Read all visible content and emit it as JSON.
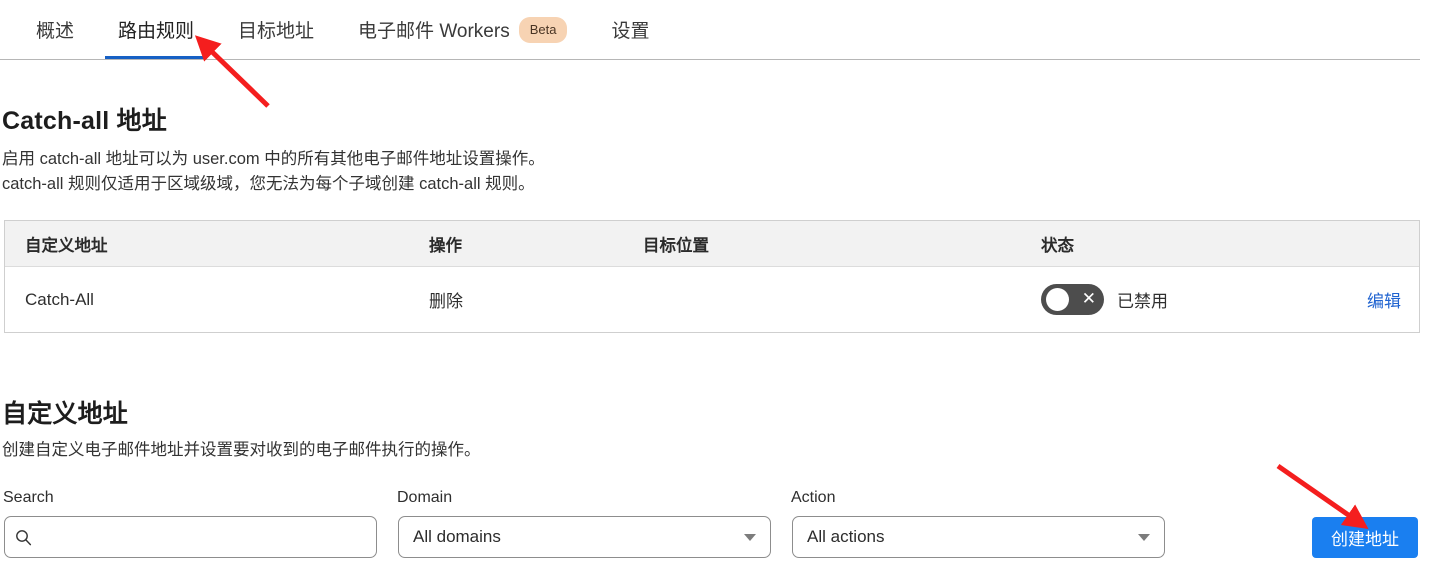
{
  "tabs": [
    {
      "label": "概述",
      "active": false,
      "badge": null
    },
    {
      "label": "路由规则",
      "active": true,
      "badge": null
    },
    {
      "label": "目标地址",
      "active": false,
      "badge": null
    },
    {
      "label": "电子邮件 Workers",
      "active": false,
      "badge": "Beta"
    },
    {
      "label": "设置",
      "active": false,
      "badge": null
    }
  ],
  "catchall": {
    "title": "Catch-all 地址",
    "description_line1": "启用 catch-all 地址可以为 user.com 中的所有其他电子邮件地址设置操作。",
    "description_line2": "catch-all 规则仅适用于区域级域，您无法为每个子域创建 catch-all 规则。",
    "table": {
      "headers": {
        "address": "自定义地址",
        "action": "操作",
        "target": "目标位置",
        "status": "状态"
      },
      "rows": [
        {
          "address": "Catch-All",
          "action": "删除",
          "target": "",
          "status_enabled": false,
          "status_text": "已禁用",
          "toggle_glyph": "✕",
          "edit_label": "编辑"
        }
      ]
    }
  },
  "custom": {
    "title": "自定义地址",
    "description": "创建自定义电子邮件地址并设置要对收到的电子邮件执行的操作。",
    "filters": {
      "search": {
        "label": "Search",
        "value": "",
        "placeholder": "",
        "icon": "search-icon"
      },
      "domain": {
        "label": "Domain",
        "selected": "All domains"
      },
      "action": {
        "label": "Action",
        "selected": "All actions"
      }
    },
    "create_button": "创建地址"
  },
  "colors": {
    "accent_blue": "#1a7ff0",
    "tab_underline": "#1660c4",
    "link_blue": "#1f63d0",
    "beta_bg": "#f7d3b3",
    "toggle_off": "#4d4d4d",
    "annotation_red": "#f41e1e",
    "table_header_bg": "#f2f2f2"
  },
  "annotations": [
    {
      "name": "arrow-to-routing-rules-tab",
      "color": "#f41e1e"
    },
    {
      "name": "arrow-to-create-address-button",
      "color": "#f41e1e"
    }
  ]
}
